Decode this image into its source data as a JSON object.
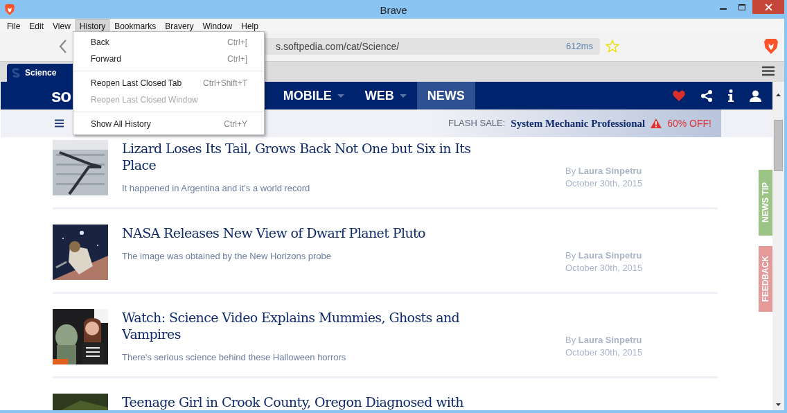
{
  "window": {
    "title": "Brave"
  },
  "menu_bar": [
    {
      "label": "File",
      "selected": false
    },
    {
      "label": "Edit",
      "selected": false
    },
    {
      "label": "View",
      "selected": false
    },
    {
      "label": "History",
      "selected": true
    },
    {
      "label": "Bookmarks",
      "selected": false
    },
    {
      "label": "Bravery",
      "selected": false
    },
    {
      "label": "Window",
      "selected": false
    },
    {
      "label": "Help",
      "selected": false
    }
  ],
  "history_menu": [
    {
      "kind": "item",
      "label": "Back",
      "shortcut": "Ctrl+[",
      "disabled": false
    },
    {
      "kind": "item",
      "label": "Forward",
      "shortcut": "Ctrl+]",
      "disabled": false
    },
    {
      "kind": "separator"
    },
    {
      "kind": "item",
      "label": "Reopen Last Closed Tab",
      "shortcut": "Ctrl+Shift+T",
      "disabled": false
    },
    {
      "kind": "item",
      "label": "Reopen Last Closed Window",
      "disabled": true
    },
    {
      "kind": "separator"
    },
    {
      "kind": "item",
      "label": "Show All History",
      "shortcut": "Ctrl+Y",
      "disabled": false
    }
  ],
  "toolbar": {
    "url": "s.softpedia.com/cat/Science/",
    "load_time": "612ms"
  },
  "tabs": [
    {
      "label": "Science",
      "selected": true
    }
  ],
  "site_nav": {
    "logo": "so",
    "items": [
      {
        "label": "MOBILE",
        "selected": false,
        "dropdown": true
      },
      {
        "label": "WEB",
        "selected": false,
        "dropdown": true
      },
      {
        "label": "NEWS",
        "selected": true,
        "dropdown": false
      }
    ]
  },
  "flash_sale": {
    "label": "FLASH SALE:",
    "product": "System Mechanic Professional",
    "offer": "60% OFF!"
  },
  "articles": [
    {
      "title": "Lizard Loses Its Tail, Grows Back Not One but Six in Its Place",
      "summary": "It happened in Argentina and it's a world record",
      "byline": "By **Laura Sinpetru**",
      "date": "October 30th, 2015"
    },
    {
      "title": "NASA Releases New View of Dwarf Planet Pluto",
      "summary": "The image was obtained by the New Horizons probe",
      "byline": "By **Laura Sinpetru**",
      "date": "October 30th, 2015"
    },
    {
      "title": "Watch: Science Video Explains Mummies, Ghosts and Vampires",
      "summary": "There's serious science behind these Halloween horrors",
      "byline": "By **Laura Sinpetru**",
      "date": "October 30th, 2015"
    },
    {
      "title": "Teenage Girl in Crook County, Oregon Diagnosed with"
    }
  ],
  "side_tabs": [
    {
      "label": "NEWS TIP",
      "color": "#9cc487"
    },
    {
      "label": "FEEDBACK",
      "color": "#e59a9a"
    }
  ]
}
